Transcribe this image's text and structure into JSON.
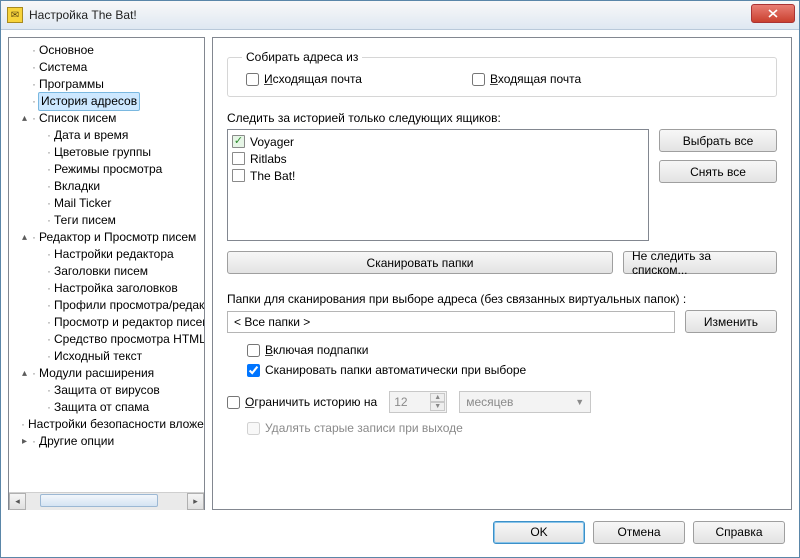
{
  "window": {
    "title": "Настройка The Bat!"
  },
  "tree": [
    {
      "label": "Основное",
      "level": 0,
      "tog": ""
    },
    {
      "label": "Система",
      "level": 0,
      "tog": ""
    },
    {
      "label": "Программы",
      "level": 0,
      "tog": ""
    },
    {
      "label": "История адресов",
      "level": 0,
      "tog": "",
      "selected": true
    },
    {
      "label": "Список писем",
      "level": 1,
      "tog": "▴"
    },
    {
      "label": "Дата и время",
      "level": 2,
      "tog": ""
    },
    {
      "label": "Цветовые группы",
      "level": 2,
      "tog": ""
    },
    {
      "label": "Режимы просмотра",
      "level": 2,
      "tog": ""
    },
    {
      "label": "Вкладки",
      "level": 2,
      "tog": ""
    },
    {
      "label": "Mail Ticker",
      "level": 2,
      "tog": ""
    },
    {
      "label": "Теги писем",
      "level": 2,
      "tog": ""
    },
    {
      "label": "Редактор и Просмотр писем",
      "level": 1,
      "tog": "▴"
    },
    {
      "label": "Настройки редактора",
      "level": 2,
      "tog": ""
    },
    {
      "label": "Заголовки писем",
      "level": 2,
      "tog": ""
    },
    {
      "label": "Настройка заголовков",
      "level": 2,
      "tog": ""
    },
    {
      "label": "Профили просмотра/редактирования",
      "level": 2,
      "tog": ""
    },
    {
      "label": "Просмотр и редактор писем",
      "level": 2,
      "tog": ""
    },
    {
      "label": "Средство просмотра HTML",
      "level": 2,
      "tog": ""
    },
    {
      "label": "Исходный текст",
      "level": 2,
      "tog": ""
    },
    {
      "label": "Модули расширения",
      "level": 1,
      "tog": "▴"
    },
    {
      "label": "Защита от вирусов",
      "level": 2,
      "tog": ""
    },
    {
      "label": "Защита от спама",
      "level": 2,
      "tog": ""
    },
    {
      "label": "Настройки безопасности вложений",
      "level": 0,
      "tog": ""
    },
    {
      "label": "Другие опции",
      "level": 1,
      "tog": "▸"
    }
  ],
  "collect": {
    "legend": "Собирать адреса из",
    "outgoing_pre": "И",
    "outgoing_rest": "сходящая почта",
    "incoming_pre": "В",
    "incoming_rest": "ходящая почта"
  },
  "watch_label": "Следить за историей только следующих ящиков:",
  "mailboxes": [
    {
      "name": "Voyager",
      "checked": true
    },
    {
      "name": "Ritlabs",
      "checked": false
    },
    {
      "name": "The Bat!",
      "checked": false
    }
  ],
  "buttons": {
    "select_all": "Выбрать все",
    "deselect_all": "Снять все",
    "scan": "Сканировать папки",
    "nofollow": "Не следить за списком...",
    "change": "Изменить",
    "ok": "OK",
    "cancel": "Отмена",
    "help": "Справка"
  },
  "folders_label": "Папки для сканирования при выборе адреса (без связанных виртуальных папок) :",
  "folders_value": "< Все папки >",
  "opt_subfolders_pre": "В",
  "opt_subfolders_rest": "ключая подпапки",
  "opt_autoscan": "Сканировать папки автоматически при выборе",
  "limit_pre": "О",
  "limit_rest": "граничить историю на",
  "limit_value": "12",
  "limit_unit": "месяцев",
  "delete_old": "Удалять старые записи при выходе"
}
